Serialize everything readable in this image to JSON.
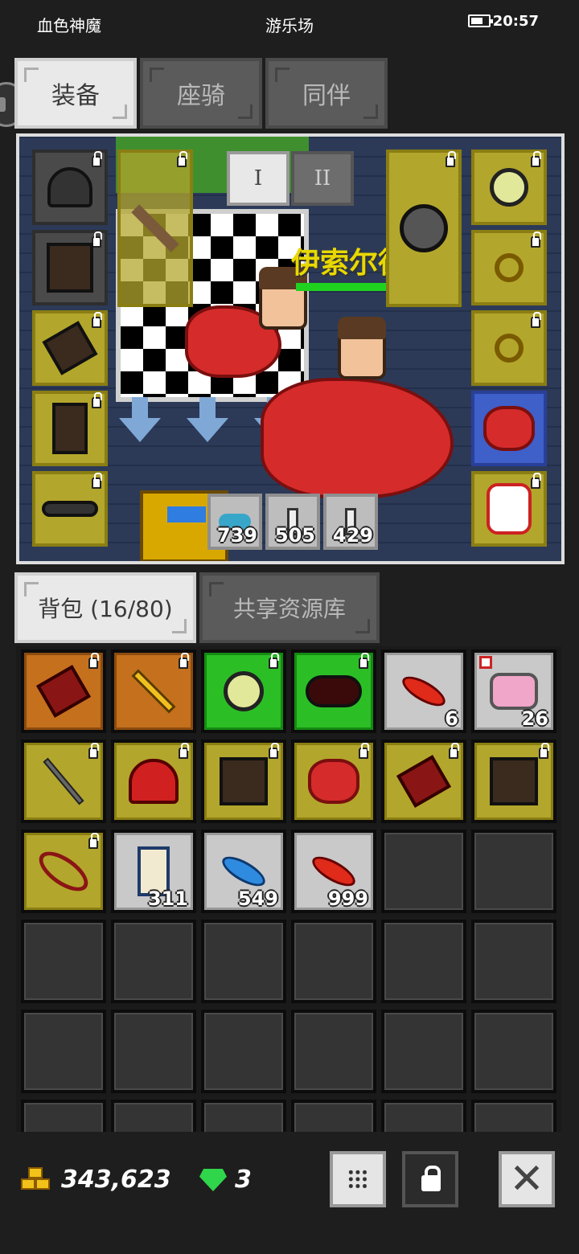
{
  "status_bar": {
    "title_left": "血色神魔",
    "title_center": "游乐场",
    "time": "20:57"
  },
  "top_tabs": [
    {
      "label": "装备",
      "active": true
    },
    {
      "label": "座骑",
      "active": false
    },
    {
      "label": "同伴",
      "active": false
    }
  ],
  "scene": {
    "character_name": "伊索尔德",
    "loadout_buttons": [
      "I",
      "II"
    ],
    "active_loadout": "I",
    "consumables": [
      {
        "icon": "fish-icon",
        "count": "739"
      },
      {
        "icon": "potion-icon",
        "count": "505"
      },
      {
        "icon": "potion-icon",
        "count": "429"
      }
    ],
    "left_slots": [
      "helmet-icon",
      "armor-icon",
      "glove-icon",
      "boots-icon",
      "belt-icon"
    ],
    "weapon_slot": "axe-icon",
    "offhand_slot": "shield-icon",
    "right_slots": [
      "necklace-icon",
      "ring-icon",
      "ring-icon",
      "dragon-mount-icon",
      "snowman-pet-icon"
    ]
  },
  "bag_tabs": [
    {
      "label": "背包 (16/80)",
      "active": true
    },
    {
      "label": "共享资源库",
      "active": false
    }
  ],
  "bag": {
    "rows": [
      [
        {
          "rarity": "orange",
          "icon": "glove-icon",
          "locked": true,
          "count": ""
        },
        {
          "rarity": "orange",
          "icon": "sword-icon",
          "locked": true,
          "count": ""
        },
        {
          "rarity": "green",
          "icon": "necklace-icon",
          "locked": true,
          "count": ""
        },
        {
          "rarity": "green",
          "icon": "dark-helmet-icon",
          "locked": true,
          "count": ""
        },
        {
          "rarity": "gray",
          "icon": "red-feather-icon",
          "locked": false,
          "count": "6"
        },
        {
          "rarity": "gray",
          "icon": "cake-icon",
          "locked": false,
          "count": "26",
          "new": true
        }
      ],
      [
        {
          "rarity": "yellow",
          "icon": "staff-icon",
          "locked": true,
          "count": ""
        },
        {
          "rarity": "yellow",
          "icon": "santa-hat-icon",
          "locked": true,
          "count": ""
        },
        {
          "rarity": "yellow",
          "icon": "armor-icon",
          "locked": true,
          "count": ""
        },
        {
          "rarity": "yellow",
          "icon": "dragon-mount-icon",
          "locked": true,
          "count": ""
        },
        {
          "rarity": "yellow",
          "icon": "glove-icon",
          "locked": true,
          "count": ""
        },
        {
          "rarity": "yellow",
          "icon": "armor-icon",
          "locked": true,
          "count": ""
        }
      ],
      [
        {
          "rarity": "yellow",
          "icon": "bow-icon",
          "locked": true,
          "count": ""
        },
        {
          "rarity": "gray",
          "icon": "scroll-icon",
          "locked": false,
          "count": "311"
        },
        {
          "rarity": "gray",
          "icon": "blue-feather-icon",
          "locked": false,
          "count": "549"
        },
        {
          "rarity": "gray",
          "icon": "red-feather-icon",
          "locked": false,
          "count": "999"
        },
        {
          "rarity": "empty",
          "icon": "",
          "locked": false,
          "count": ""
        },
        {
          "rarity": "empty",
          "icon": "",
          "locked": false,
          "count": ""
        }
      ]
    ]
  },
  "footer": {
    "gold": "343,623",
    "gems": "3"
  },
  "colors": {
    "rarity_orange": "#c4701d",
    "rarity_green": "#2bbf25",
    "rarity_yellow": "#b3a62c",
    "rarity_gray": "#c9c9c9",
    "name_tag": "#e8d800"
  }
}
